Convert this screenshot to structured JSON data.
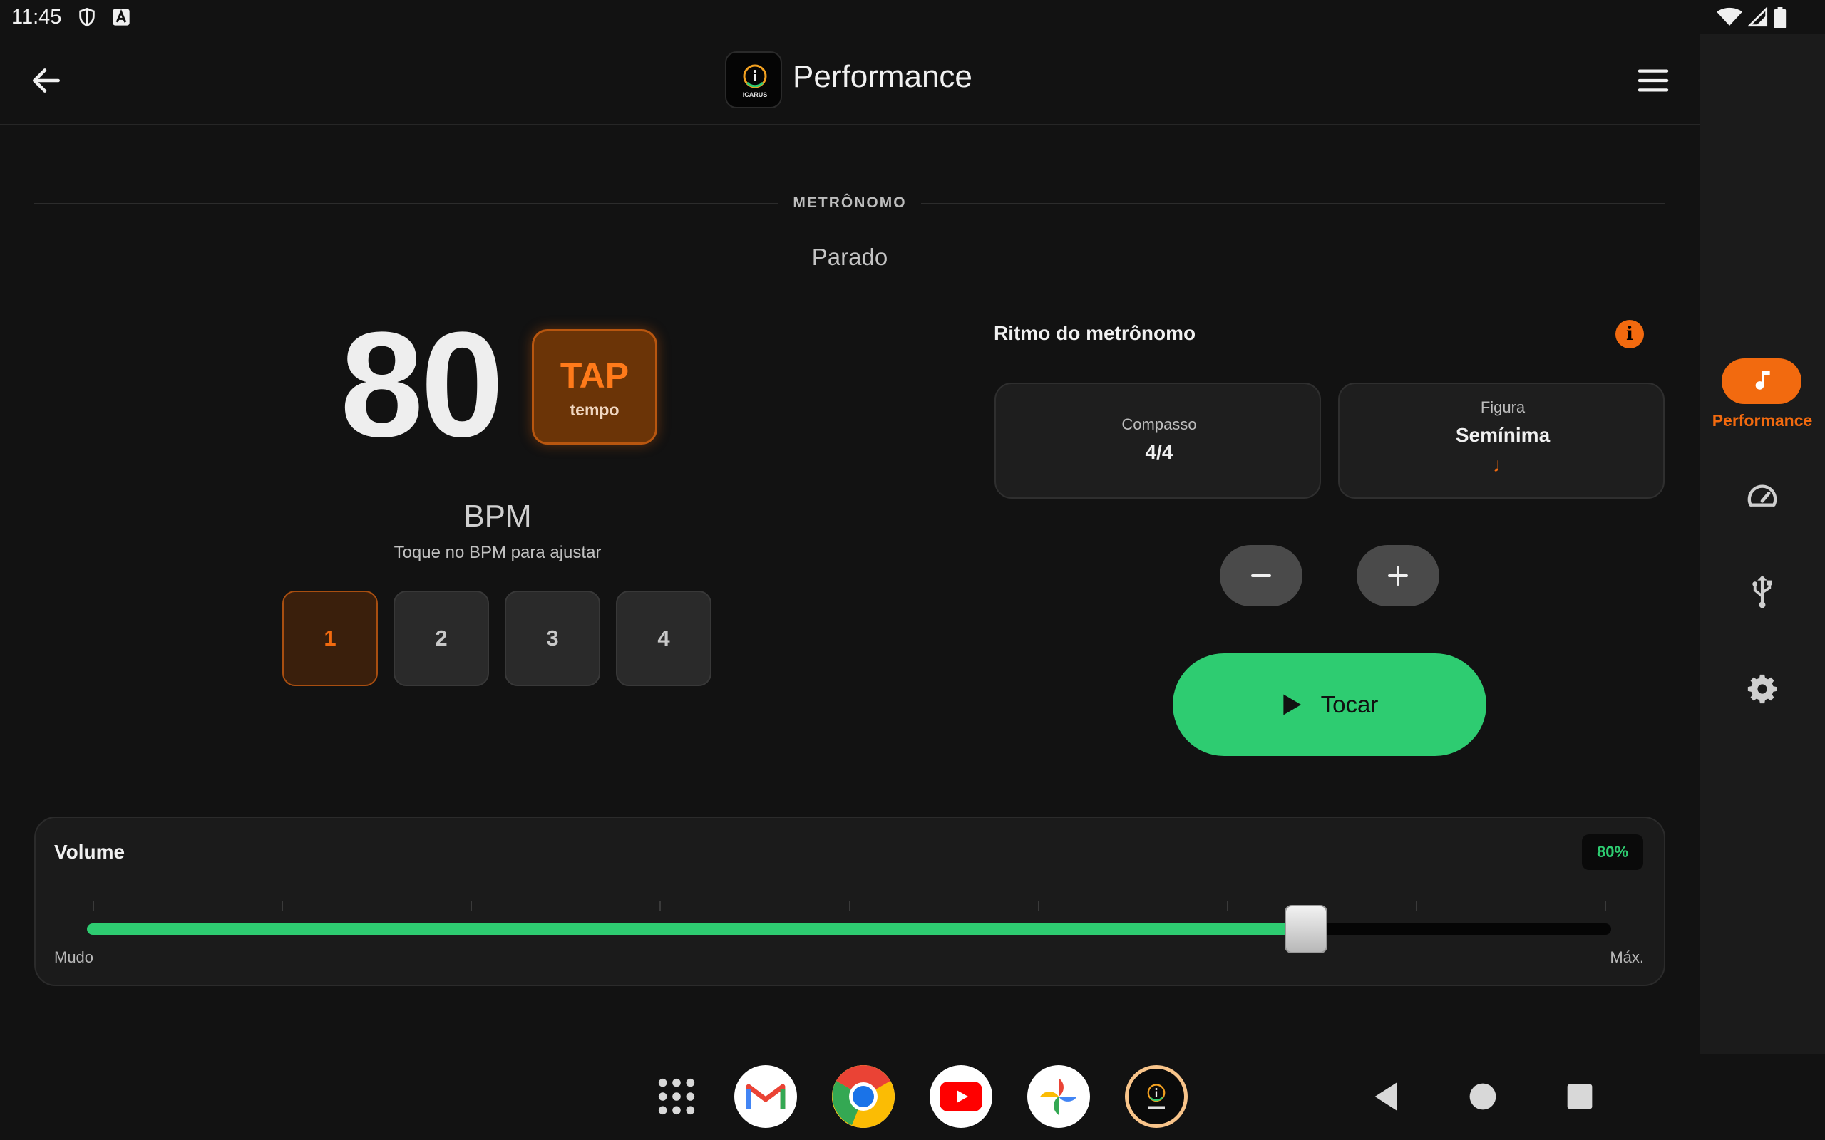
{
  "status_bar": {
    "time": "11:45"
  },
  "app_bar": {
    "title": "Performance",
    "logo_text": "ICARUS"
  },
  "rail": {
    "active_label": "Performance"
  },
  "metronome": {
    "section_title": "METRÔNOMO",
    "state": "Parado",
    "bpm_value": "80",
    "tap_label": "TAP",
    "tap_sub": "tempo",
    "bpm_label": "BPM",
    "bpm_hint": "Toque no BPM para ajustar",
    "beats": [
      "1",
      "2",
      "3",
      "4"
    ],
    "active_beat": 1
  },
  "rhythm": {
    "title": "Ritmo do metrônomo",
    "time_signature_label": "Compasso",
    "time_signature_value": "4/4",
    "figure_label": "Figura",
    "figure_value": "Semínima",
    "figure_symbol": "♩",
    "play_label": "Tocar"
  },
  "volume": {
    "title": "Volume",
    "level_percent": 80,
    "badge": "80%",
    "min_label": "Mudo",
    "max_label": "Máx."
  },
  "colors": {
    "accent": "#f26a0f",
    "play": "#2ecc71",
    "background": "#121212"
  }
}
